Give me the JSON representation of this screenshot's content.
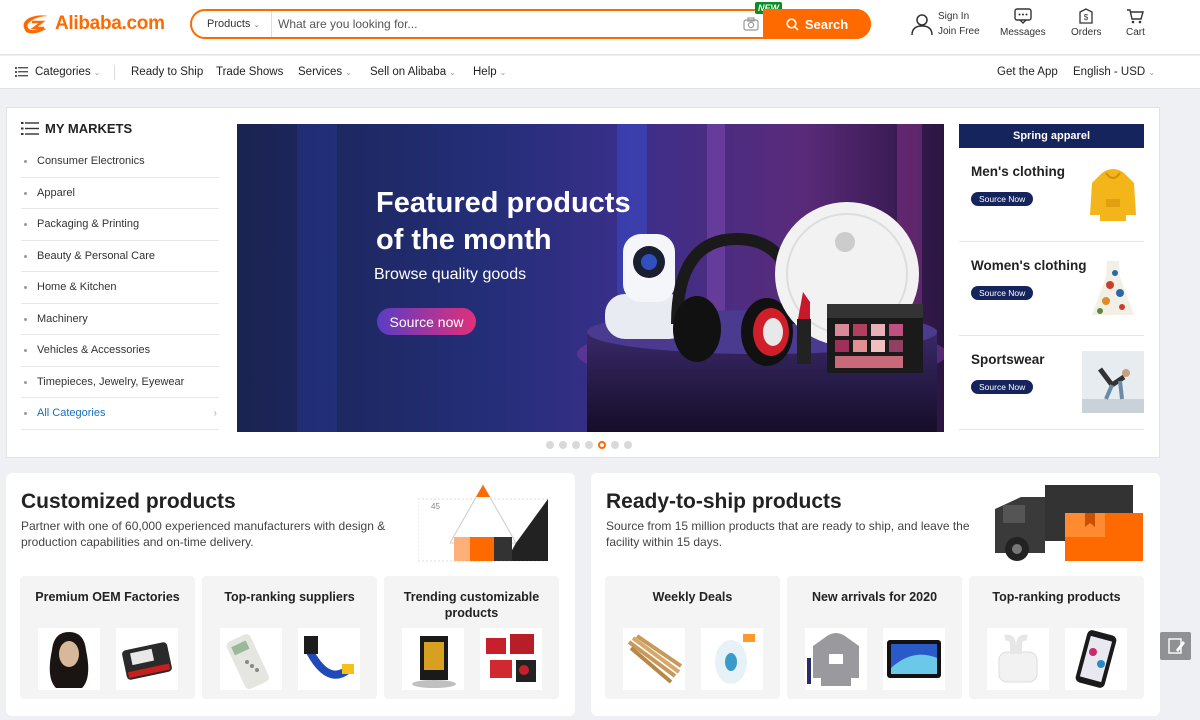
{
  "header": {
    "logo_text": "Alibaba.com",
    "search": {
      "category": "Products",
      "placeholder": "What are you looking for...",
      "button": "Search",
      "new_badge": "NEW"
    },
    "signin": {
      "line1": "Sign In",
      "line2": "Join Free"
    },
    "messages": "Messages",
    "orders": "Orders",
    "cart": "Cart"
  },
  "nav": {
    "categories": "Categories",
    "ready": "Ready to Ship",
    "trade": "Trade Shows",
    "services": "Services",
    "sell": "Sell on Alibaba",
    "help": "Help",
    "app": "Get the App",
    "lang": "English - USD"
  },
  "markets": {
    "title": "MY MARKETS",
    "items": [
      "Consumer Electronics",
      "Apparel",
      "Packaging & Printing",
      "Beauty & Personal Care",
      "Home & Kitchen",
      "Machinery",
      "Vehicles & Accessories",
      "Timepieces, Jewelry, Eyewear",
      "All Categories"
    ]
  },
  "banner": {
    "title1": "Featured products",
    "title2": "of the month",
    "sub": "Browse quality goods",
    "cta": "Source now"
  },
  "spring": {
    "title": "Spring apparel",
    "cards": [
      {
        "label": "Men's clothing",
        "btn": "Source Now"
      },
      {
        "label": "Women's clothing",
        "btn": "Source Now"
      },
      {
        "label": "Sportswear",
        "btn": "Source Now"
      }
    ]
  },
  "customized": {
    "title": "Customized products",
    "desc1": "Partner with one of 60,000 experienced manufacturers with design &",
    "desc2": "production capabilities and on-time delivery.",
    "graphic_num1": "45",
    "graphic_num2": "45",
    "tiles": [
      "Premium OEM Factories",
      "Top-ranking suppliers",
      "Trending customizable products"
    ]
  },
  "ready": {
    "title": "Ready-to-ship products",
    "desc1": "Source from 15 million products that are ready to ship, and leave the",
    "desc2": "facility within 15 days.",
    "tiles": [
      "Weekly Deals",
      "New arrivals for 2020",
      "Top-ranking products"
    ]
  },
  "colors": {
    "accent": "#ff6a00",
    "navy": "#15245c",
    "link": "#1a6fb8"
  }
}
